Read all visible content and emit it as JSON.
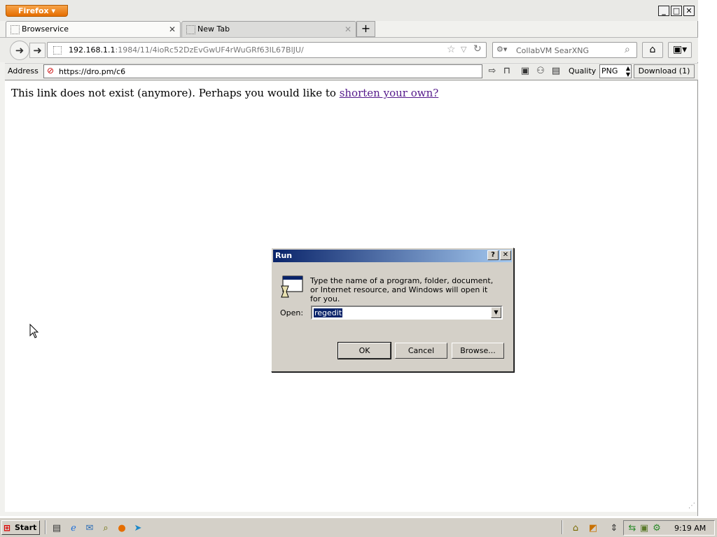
{
  "firefox": {
    "menu_button": "Firefox",
    "window_controls": {
      "minimize": "_",
      "maximize": "□",
      "close": "✕"
    },
    "tabs": [
      {
        "label": "Browservice",
        "active": true
      },
      {
        "label": "New Tab",
        "active": false
      }
    ],
    "new_tab_symbol": "+",
    "url": {
      "host": "192.168.1.1",
      "rest": ":1984/11/4ioRc52DzEvGwUF4rWuGRf63IL67BlJU/"
    },
    "search_placeholder": "CollabVM SearXNG",
    "icons": {
      "back": "back-arrow-icon",
      "forward": "forward-arrow-icon",
      "home": "home-icon",
      "addons": "puzzle-icon"
    }
  },
  "browservice_toolbar": {
    "address_label": "Address",
    "address_value": "https://dro.pm/c6",
    "quality_label": "Quality",
    "quality_value": "PNG",
    "download_label": "Download (1)"
  },
  "page": {
    "message": "This link does not exist (anymore). Perhaps you would like to",
    "link_text": "shorten your own?"
  },
  "run_dialog": {
    "title": "Run",
    "help": "?",
    "close": "✕",
    "description": "Type the name of a program, folder, document, or Internet resource, and Windows will open it for you.",
    "open_label": "Open:",
    "open_value": "regedit",
    "ok": "OK",
    "cancel": "Cancel",
    "browse": "Browse..."
  },
  "taskbar": {
    "start_label": "Start",
    "clock": "9:19 AM"
  },
  "colors": {
    "titlebar_active": "#0a246a",
    "link": "#551a8b",
    "firefox_orange": "#e56d00",
    "system_face": "#d4d0c8"
  }
}
